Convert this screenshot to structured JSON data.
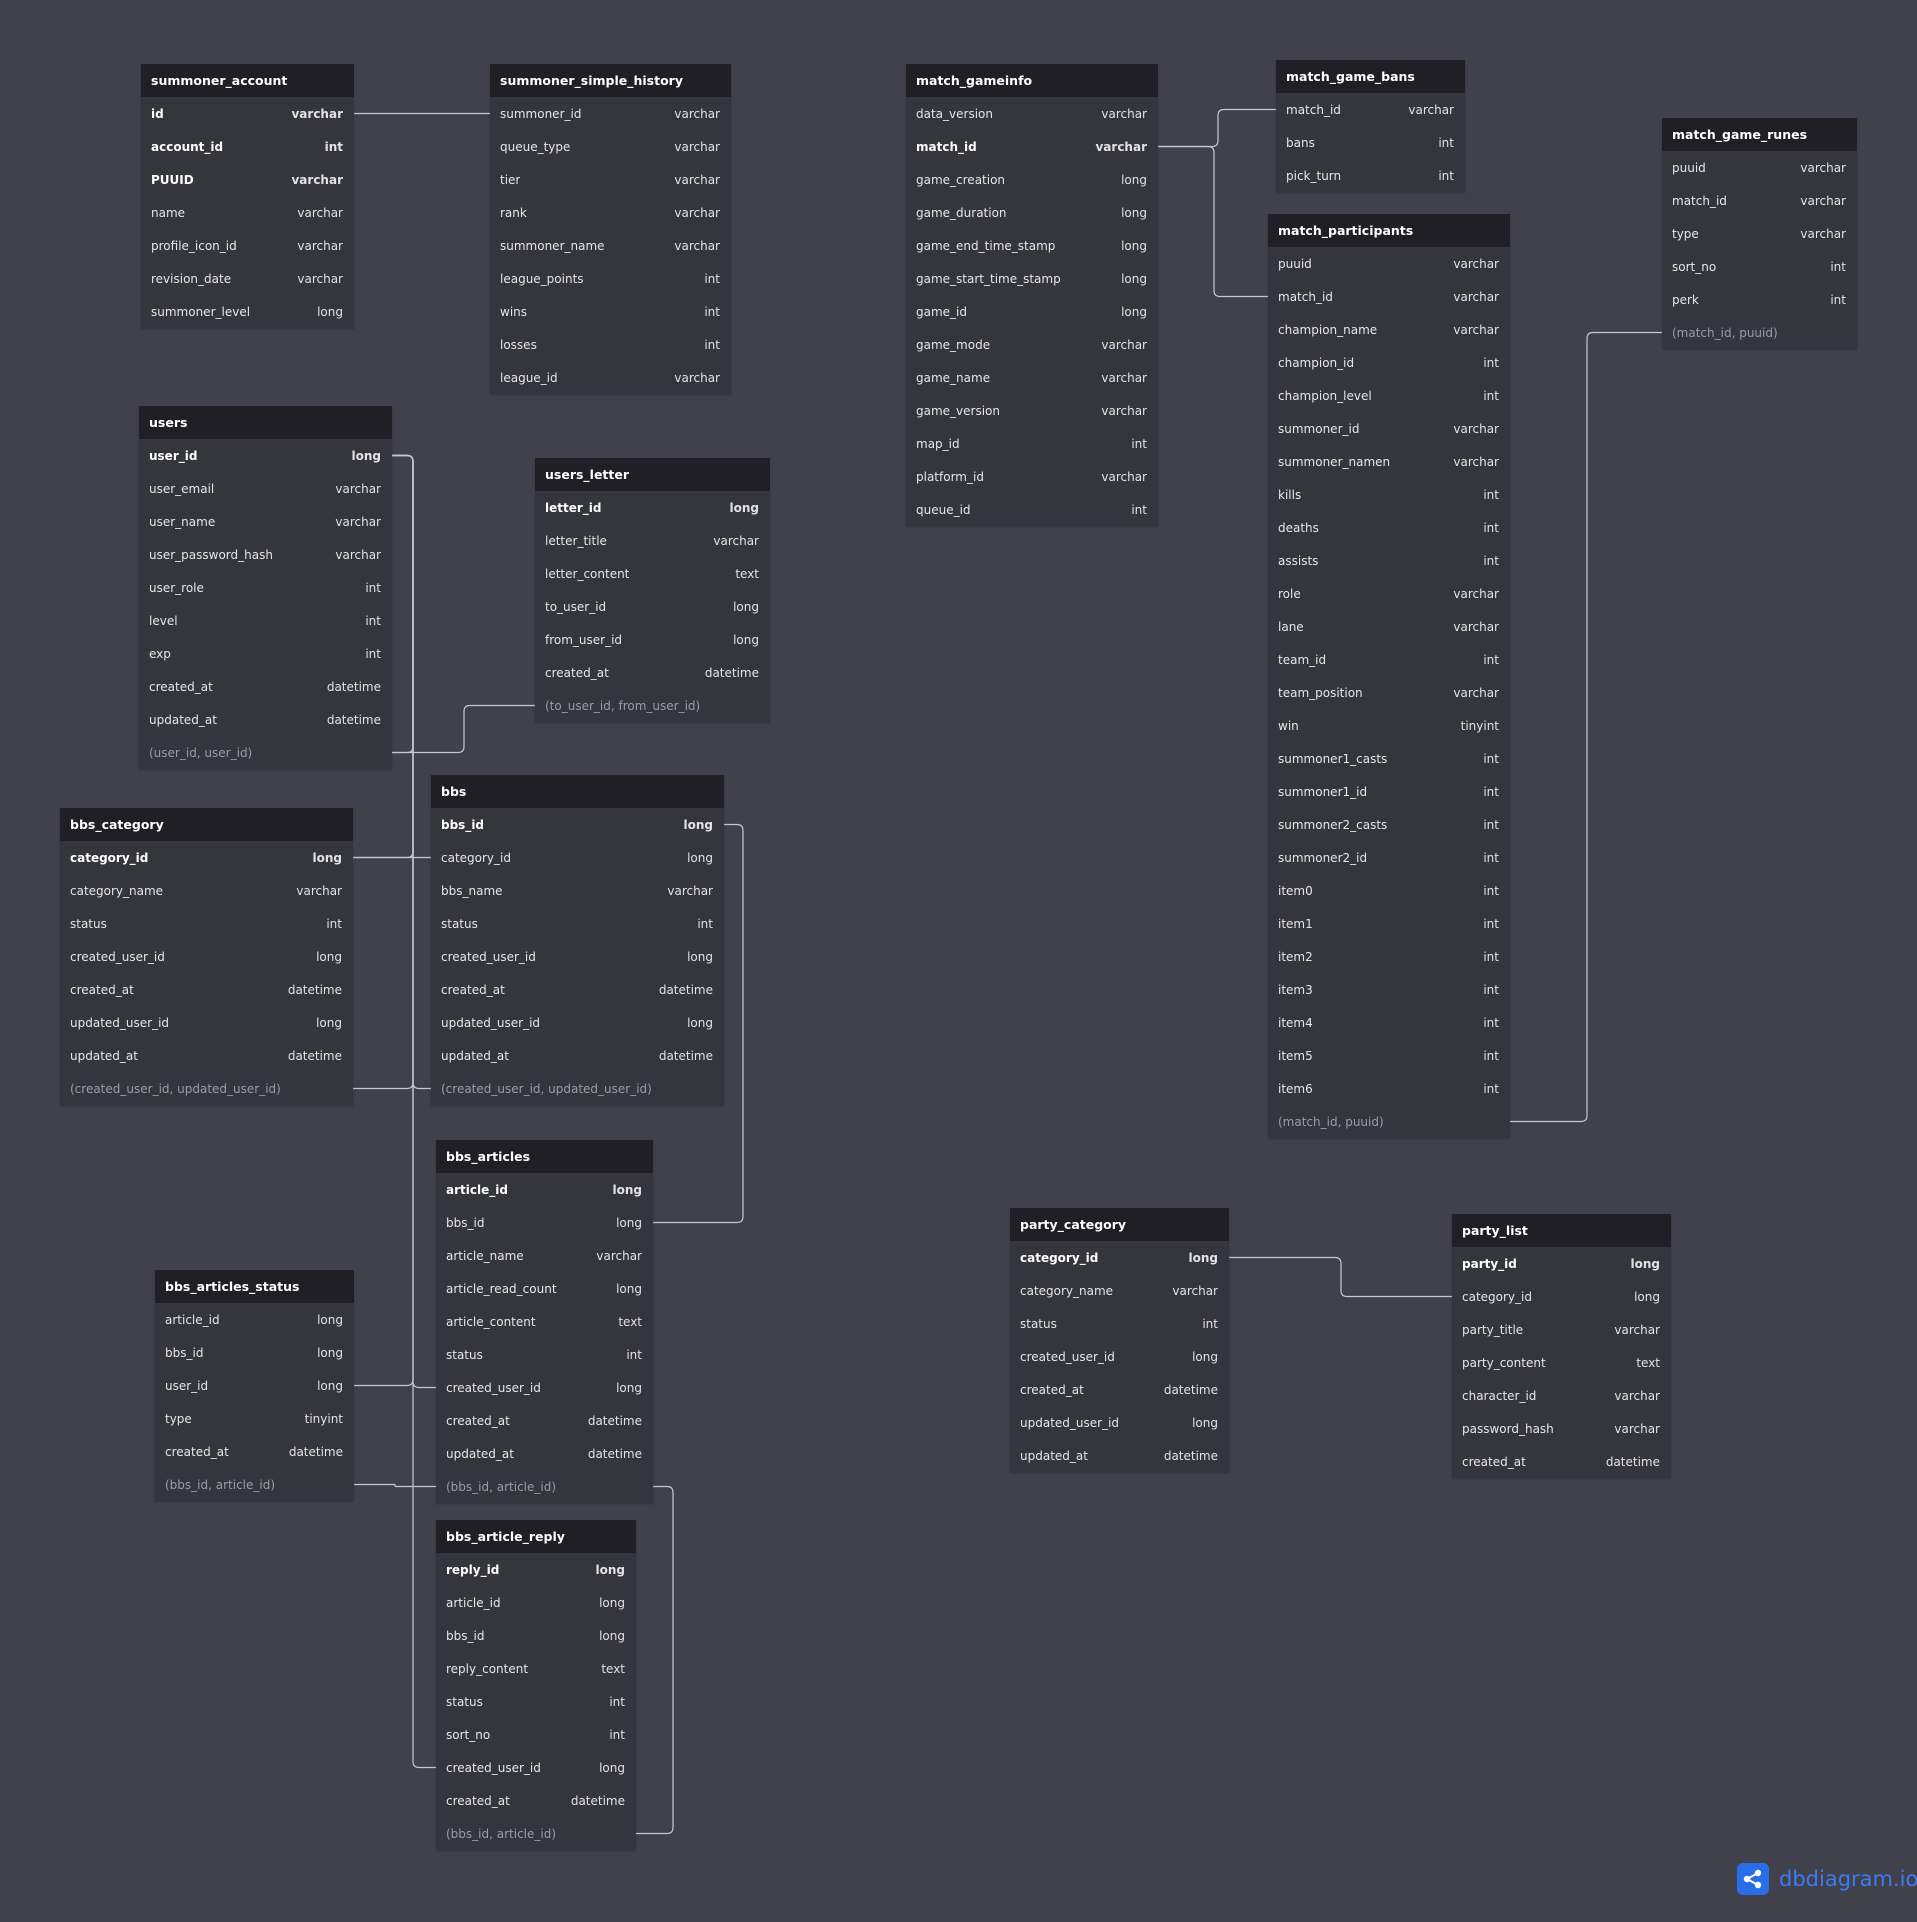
{
  "brand": {
    "name": "dbdiagram.io",
    "icon": "share-nodes-icon",
    "accent": "#2a6de8"
  },
  "tables": [
    {
      "id": "summoner_account",
      "name": "summoner_account",
      "fields": [
        {
          "name": "id",
          "type": "varchar",
          "pk": true
        },
        {
          "name": "account_id",
          "type": "int",
          "pk": true
        },
        {
          "name": "PUUID",
          "type": "varchar",
          "pk": true
        },
        {
          "name": "name",
          "type": "varchar"
        },
        {
          "name": "profile_icon_id",
          "type": "varchar"
        },
        {
          "name": "revision_date",
          "type": "varchar"
        },
        {
          "name": "summoner_level",
          "type": "long"
        }
      ]
    },
    {
      "id": "summoner_simple_history",
      "name": "summoner_simple_history",
      "fields": [
        {
          "name": "summoner_id",
          "type": "varchar"
        },
        {
          "name": "queue_type",
          "type": "varchar"
        },
        {
          "name": "tier",
          "type": "varchar"
        },
        {
          "name": "rank",
          "type": "varchar"
        },
        {
          "name": "summoner_name",
          "type": "varchar"
        },
        {
          "name": "league_points",
          "type": "int"
        },
        {
          "name": "wins",
          "type": "int"
        },
        {
          "name": "losses",
          "type": "int"
        },
        {
          "name": "league_id",
          "type": "varchar"
        }
      ]
    },
    {
      "id": "match_gameinfo",
      "name": "match_gameinfo",
      "fields": [
        {
          "name": "data_version",
          "type": "varchar"
        },
        {
          "name": "match_id",
          "type": "varchar",
          "pk": true
        },
        {
          "name": "game_creation",
          "type": "long"
        },
        {
          "name": "game_duration",
          "type": "long"
        },
        {
          "name": "game_end_time_stamp",
          "type": "long"
        },
        {
          "name": "game_start_time_stamp",
          "type": "long"
        },
        {
          "name": "game_id",
          "type": "long"
        },
        {
          "name": "game_mode",
          "type": "varchar"
        },
        {
          "name": "game_name",
          "type": "varchar"
        },
        {
          "name": "game_version",
          "type": "varchar"
        },
        {
          "name": "map_id",
          "type": "int"
        },
        {
          "name": "platform_id",
          "type": "varchar"
        },
        {
          "name": "queue_id",
          "type": "int"
        }
      ]
    },
    {
      "id": "match_game_bans",
      "name": "match_game_bans",
      "fields": [
        {
          "name": "match_id",
          "type": "varchar"
        },
        {
          "name": "bans",
          "type": "int"
        },
        {
          "name": "pick_turn",
          "type": "int"
        }
      ]
    },
    {
      "id": "match_game_runes",
      "name": "match_game_runes",
      "fields": [
        {
          "name": "puuid",
          "type": "varchar"
        },
        {
          "name": "match_id",
          "type": "varchar"
        },
        {
          "name": "type",
          "type": "varchar"
        },
        {
          "name": "sort_no",
          "type": "int"
        },
        {
          "name": "perk",
          "type": "int"
        },
        {
          "name": "(match_id, puuid)",
          "type": "",
          "idx": true
        }
      ]
    },
    {
      "id": "match_participants",
      "name": "match_participants",
      "fields": [
        {
          "name": "puuid",
          "type": "varchar"
        },
        {
          "name": "match_id",
          "type": "varchar"
        },
        {
          "name": "champion_name",
          "type": "varchar"
        },
        {
          "name": "champion_id",
          "type": "int"
        },
        {
          "name": "champion_level",
          "type": "int"
        },
        {
          "name": "summoner_id",
          "type": "varchar"
        },
        {
          "name": "summoner_namen",
          "type": "varchar"
        },
        {
          "name": "kills",
          "type": "int"
        },
        {
          "name": "deaths",
          "type": "int"
        },
        {
          "name": "assists",
          "type": "int"
        },
        {
          "name": "role",
          "type": "varchar"
        },
        {
          "name": "lane",
          "type": "varchar"
        },
        {
          "name": "team_id",
          "type": "int"
        },
        {
          "name": "team_position",
          "type": "varchar"
        },
        {
          "name": "win",
          "type": "tinyint"
        },
        {
          "name": "summoner1_casts",
          "type": "int"
        },
        {
          "name": "summoner1_id",
          "type": "int"
        },
        {
          "name": "summoner2_casts",
          "type": "int"
        },
        {
          "name": "summoner2_id",
          "type": "int"
        },
        {
          "name": "item0",
          "type": "int"
        },
        {
          "name": "item1",
          "type": "int"
        },
        {
          "name": "item2",
          "type": "int"
        },
        {
          "name": "item3",
          "type": "int"
        },
        {
          "name": "item4",
          "type": "int"
        },
        {
          "name": "item5",
          "type": "int"
        },
        {
          "name": "item6",
          "type": "int"
        },
        {
          "name": "(match_id, puuid)",
          "type": "",
          "idx": true
        }
      ]
    },
    {
      "id": "users",
      "name": "users",
      "fields": [
        {
          "name": "user_id",
          "type": "long",
          "pk": true
        },
        {
          "name": "user_email",
          "type": "varchar"
        },
        {
          "name": "user_name",
          "type": "varchar"
        },
        {
          "name": "user_password_hash",
          "type": "varchar"
        },
        {
          "name": "user_role",
          "type": "int"
        },
        {
          "name": "level",
          "type": "int"
        },
        {
          "name": "exp",
          "type": "int"
        },
        {
          "name": "created_at",
          "type": "datetime"
        },
        {
          "name": "updated_at",
          "type": "datetime"
        },
        {
          "name": "(user_id, user_id)",
          "type": "",
          "idx": true
        }
      ]
    },
    {
      "id": "users_letter",
      "name": "users_letter",
      "fields": [
        {
          "name": "letter_id",
          "type": "long",
          "pk": true
        },
        {
          "name": "letter_title",
          "type": "varchar"
        },
        {
          "name": "letter_content",
          "type": "text"
        },
        {
          "name": "to_user_id",
          "type": "long"
        },
        {
          "name": "from_user_id",
          "type": "long"
        },
        {
          "name": "created_at",
          "type": "datetime"
        },
        {
          "name": "(to_user_id, from_user_id)",
          "type": "",
          "idx": true
        }
      ]
    },
    {
      "id": "bbs_category",
      "name": "bbs_category",
      "fields": [
        {
          "name": "category_id",
          "type": "long",
          "pk": true
        },
        {
          "name": "category_name",
          "type": "varchar"
        },
        {
          "name": "status",
          "type": "int"
        },
        {
          "name": "created_user_id",
          "type": "long"
        },
        {
          "name": "created_at",
          "type": "datetime"
        },
        {
          "name": "updated_user_id",
          "type": "long"
        },
        {
          "name": "updated_at",
          "type": "datetime"
        },
        {
          "name": "(created_user_id, updated_user_id)",
          "type": "",
          "idx": true
        }
      ]
    },
    {
      "id": "bbs",
      "name": "bbs",
      "fields": [
        {
          "name": "bbs_id",
          "type": "long",
          "pk": true
        },
        {
          "name": "category_id",
          "type": "long"
        },
        {
          "name": "bbs_name",
          "type": "varchar"
        },
        {
          "name": "status",
          "type": "int"
        },
        {
          "name": "created_user_id",
          "type": "long"
        },
        {
          "name": "created_at",
          "type": "datetime"
        },
        {
          "name": "updated_user_id",
          "type": "long"
        },
        {
          "name": "updated_at",
          "type": "datetime"
        },
        {
          "name": "(created_user_id, updated_user_id)",
          "type": "",
          "idx": true
        }
      ]
    },
    {
      "id": "bbs_articles",
      "name": "bbs_articles",
      "fields": [
        {
          "name": "article_id",
          "type": "long",
          "pk": true
        },
        {
          "name": "bbs_id",
          "type": "long"
        },
        {
          "name": "article_name",
          "type": "varchar"
        },
        {
          "name": "article_read_count",
          "type": "long"
        },
        {
          "name": "article_content",
          "type": "text"
        },
        {
          "name": "status",
          "type": "int"
        },
        {
          "name": "created_user_id",
          "type": "long"
        },
        {
          "name": "created_at",
          "type": "datetime"
        },
        {
          "name": "updated_at",
          "type": "datetime"
        },
        {
          "name": "(bbs_id, article_id)",
          "type": "",
          "idx": true
        }
      ]
    },
    {
      "id": "bbs_articles_status",
      "name": "bbs_articles_status",
      "fields": [
        {
          "name": "article_id",
          "type": "long"
        },
        {
          "name": "bbs_id",
          "type": "long"
        },
        {
          "name": "user_id",
          "type": "long"
        },
        {
          "name": "type",
          "type": "tinyint"
        },
        {
          "name": "created_at",
          "type": "datetime"
        },
        {
          "name": "(bbs_id, article_id)",
          "type": "",
          "idx": true
        }
      ]
    },
    {
      "id": "bbs_article_reply",
      "name": "bbs_article_reply",
      "fields": [
        {
          "name": "reply_id",
          "type": "long",
          "pk": true
        },
        {
          "name": "article_id",
          "type": "long"
        },
        {
          "name": "bbs_id",
          "type": "long"
        },
        {
          "name": "reply_content",
          "type": "text"
        },
        {
          "name": "status",
          "type": "int"
        },
        {
          "name": "sort_no",
          "type": "int"
        },
        {
          "name": "created_user_id",
          "type": "long"
        },
        {
          "name": "created_at",
          "type": "datetime"
        },
        {
          "name": "(bbs_id, article_id)",
          "type": "",
          "idx": true
        }
      ]
    },
    {
      "id": "party_category",
      "name": "party_category",
      "fields": [
        {
          "name": "category_id",
          "type": "long",
          "pk": true
        },
        {
          "name": "category_name",
          "type": "varchar"
        },
        {
          "name": "status",
          "type": "int"
        },
        {
          "name": "created_user_id",
          "type": "long"
        },
        {
          "name": "created_at",
          "type": "datetime"
        },
        {
          "name": "updated_user_id",
          "type": "long"
        },
        {
          "name": "updated_at",
          "type": "datetime"
        }
      ]
    },
    {
      "id": "party_list",
      "name": "party_list",
      "fields": [
        {
          "name": "party_id",
          "type": "long",
          "pk": true
        },
        {
          "name": "category_id",
          "type": "long"
        },
        {
          "name": "party_title",
          "type": "varchar"
        },
        {
          "name": "party_content",
          "type": "text"
        },
        {
          "name": "character_id",
          "type": "varchar"
        },
        {
          "name": "password_hash",
          "type": "varchar"
        },
        {
          "name": "created_at",
          "type": "datetime"
        }
      ]
    }
  ],
  "relations": [
    {
      "from": "summoner_account.id",
      "to": "summoner_simple_history.summoner_id"
    },
    {
      "from": "match_gameinfo.match_id",
      "to": "match_game_bans.match_id"
    },
    {
      "from": "match_gameinfo.match_id",
      "to": "match_participants.match_id"
    },
    {
      "from": "match_participants.(match_id, puuid)",
      "to": "match_game_runes.(match_id, puuid)"
    },
    {
      "from": "users.user_id",
      "to": "users.(user_id, user_id)"
    },
    {
      "from": "users.(user_id, user_id)",
      "to": "users_letter.(to_user_id, from_user_id)"
    },
    {
      "from": "users.user_id",
      "to": "bbs_category.category_id"
    },
    {
      "from": "users.user_id",
      "to": "bbs_category.(created_user_id, updated_user_id)"
    },
    {
      "from": "users.user_id",
      "to": "bbs.(created_user_id, updated_user_id)"
    },
    {
      "from": "bbs_category.category_id",
      "to": "bbs.category_id"
    },
    {
      "from": "users.user_id",
      "to": "bbs_articles_status.user_id"
    },
    {
      "from": "users.user_id",
      "to": "bbs_articles.created_user_id"
    },
    {
      "from": "users.user_id",
      "to": "bbs_article_reply.created_user_id"
    },
    {
      "from": "bbs.bbs_id",
      "to": "bbs_articles.bbs_id"
    },
    {
      "from": "bbs_articles_status.(bbs_id, article_id)",
      "to": "bbs_articles.(bbs_id, article_id)"
    },
    {
      "from": "bbs_articles.(bbs_id, article_id)",
      "to": "bbs_article_reply.(bbs_id, article_id)"
    },
    {
      "from": "party_category.category_id",
      "to": "party_list.category_id"
    }
  ]
}
